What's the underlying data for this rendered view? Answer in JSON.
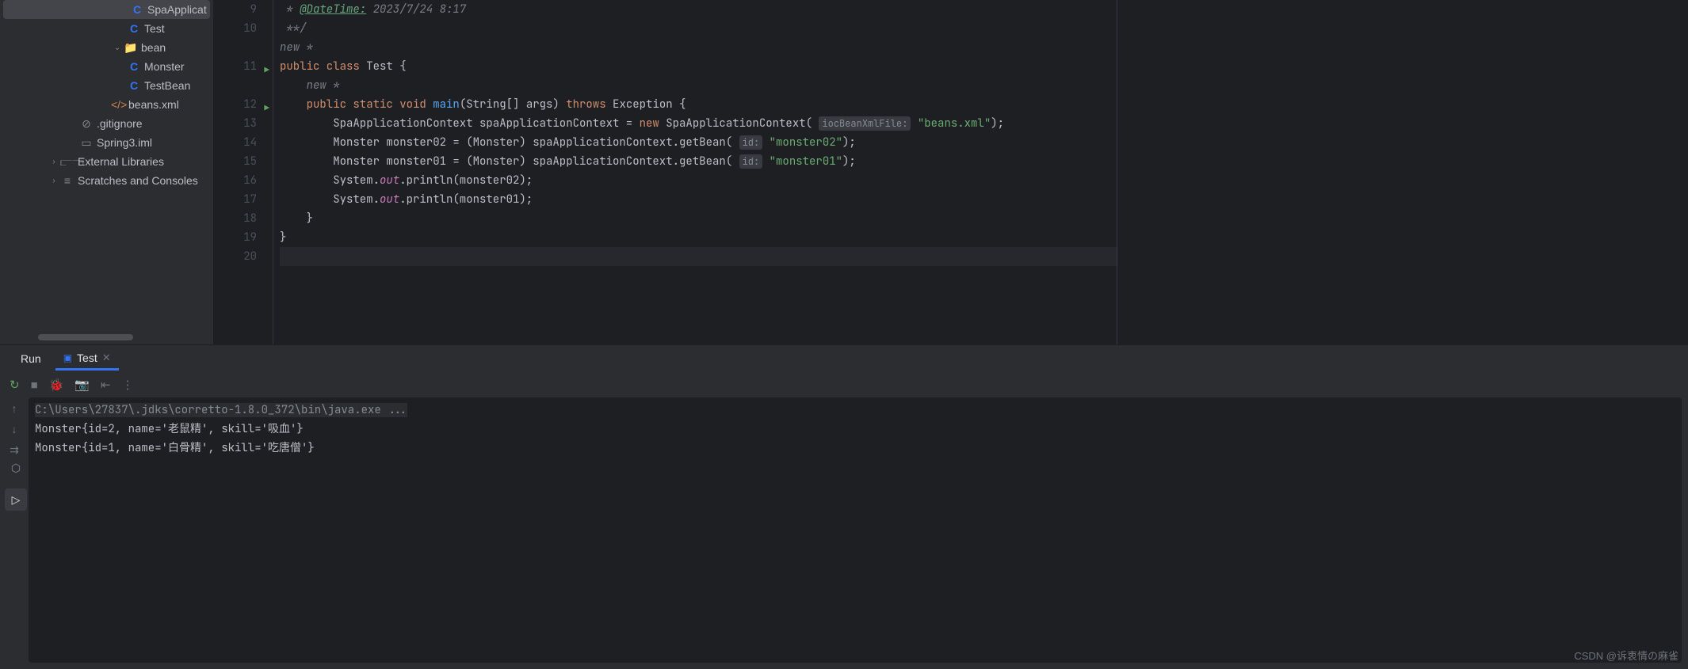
{
  "sidebar": {
    "items": [
      {
        "label": "SpaApplicat",
        "icon": "C",
        "iconClass": "icon-class",
        "indent": "indent-4",
        "selected": true
      },
      {
        "label": "Test",
        "icon": "C",
        "iconClass": "icon-class",
        "indent": "indent-4"
      },
      {
        "label": "bean",
        "icon": "📁",
        "iconClass": "icon-folder",
        "indent": "indent-3",
        "chevron": "⌄"
      },
      {
        "label": "Monster",
        "icon": "C",
        "iconClass": "icon-class",
        "indent": "indent-4"
      },
      {
        "label": "TestBean",
        "icon": "C",
        "iconClass": "icon-class",
        "indent": "indent-4"
      },
      {
        "label": "beans.xml",
        "icon": "</>",
        "iconClass": "icon-xml",
        "indent": "indent-3"
      },
      {
        "label": ".gitignore",
        "icon": "⊘",
        "iconClass": "icon-gitignore",
        "indent": "indent-2"
      },
      {
        "label": "Spring3.iml",
        "icon": "▭",
        "iconClass": "icon-iml",
        "indent": "indent-2"
      },
      {
        "label": "External Libraries",
        "icon": "⫍⫎",
        "iconClass": "icon-folder",
        "indent": "indent-1",
        "chevron": "›"
      },
      {
        "label": "Scratches and Consoles",
        "icon": "≡",
        "iconClass": "icon-folder",
        "indent": "indent-1",
        "chevron": "›"
      }
    ]
  },
  "editor": {
    "lines": [
      {
        "num": "9",
        "segments": [
          {
            "t": " * ",
            "c": "c-comment"
          },
          {
            "t": "@DateTime:",
            "c": "c-doctag"
          },
          {
            "t": " 2023/7/24 8:17",
            "c": "c-comment"
          }
        ]
      },
      {
        "num": "10",
        "segments": [
          {
            "t": " **/",
            "c": "c-comment"
          }
        ]
      },
      {
        "num": "",
        "segments": [
          {
            "t": "new *",
            "c": "c-new"
          }
        ]
      },
      {
        "num": "11",
        "run": true,
        "segments": [
          {
            "t": "public class ",
            "c": "c-keyword"
          },
          {
            "t": "Test {",
            "c": "c-default"
          }
        ]
      },
      {
        "num": "",
        "segments": [
          {
            "t": "    new *",
            "c": "c-new"
          }
        ]
      },
      {
        "num": "12",
        "run": true,
        "segments": [
          {
            "t": "    ",
            "c": ""
          },
          {
            "t": "public static void ",
            "c": "c-keyword"
          },
          {
            "t": "main",
            "c": "c-method"
          },
          {
            "t": "(String[] args) ",
            "c": "c-default"
          },
          {
            "t": "throws ",
            "c": "c-keyword"
          },
          {
            "t": "Exception {",
            "c": "c-default"
          }
        ]
      },
      {
        "num": "13",
        "segments": [
          {
            "t": "        SpaApplicationContext spaApplicationContext = ",
            "c": "c-default"
          },
          {
            "t": "new ",
            "c": "c-keyword"
          },
          {
            "t": "SpaApplicationContext( ",
            "c": "c-default"
          },
          {
            "t": "iocBeanXmlFile:",
            "c": "c-hint"
          },
          {
            "t": " ",
            "c": ""
          },
          {
            "t": "\"beans.xml\"",
            "c": "c-string"
          },
          {
            "t": ");",
            "c": "c-default"
          }
        ]
      },
      {
        "num": "14",
        "segments": [
          {
            "t": "        Monster monster02 = (Monster) spaApplicationContext.getBean( ",
            "c": "c-default"
          },
          {
            "t": "id:",
            "c": "c-hint"
          },
          {
            "t": " ",
            "c": ""
          },
          {
            "t": "\"monster02\"",
            "c": "c-string"
          },
          {
            "t": ");",
            "c": "c-default"
          }
        ]
      },
      {
        "num": "15",
        "segments": [
          {
            "t": "        Monster monster01 = (Monster) spaApplicationContext.getBean( ",
            "c": "c-default"
          },
          {
            "t": "id:",
            "c": "c-hint"
          },
          {
            "t": " ",
            "c": ""
          },
          {
            "t": "\"monster01\"",
            "c": "c-string"
          },
          {
            "t": ");",
            "c": "c-default"
          }
        ]
      },
      {
        "num": "16",
        "segments": [
          {
            "t": "        System.",
            "c": "c-default"
          },
          {
            "t": "out",
            "c": "c-field"
          },
          {
            "t": ".println(monster02);",
            "c": "c-default"
          }
        ]
      },
      {
        "num": "17",
        "segments": [
          {
            "t": "        System.",
            "c": "c-default"
          },
          {
            "t": "out",
            "c": "c-field"
          },
          {
            "t": ".println(monster01);",
            "c": "c-default"
          }
        ]
      },
      {
        "num": "18",
        "segments": [
          {
            "t": "    }",
            "c": "c-default"
          }
        ]
      },
      {
        "num": "19",
        "segments": [
          {
            "t": "}",
            "c": "c-default"
          }
        ]
      },
      {
        "num": "20",
        "cursor": true,
        "segments": [
          {
            "t": "",
            "c": ""
          }
        ]
      }
    ]
  },
  "run": {
    "label": "Run",
    "tab": "Test",
    "console": {
      "cmd": "C:\\Users\\27837\\.jdks\\corretto-1.8.0_372\\bin\\java.exe ...",
      "out1": "Monster{id=2, name='老鼠精', skill='吸血'}",
      "out2": "Monster{id=1, name='白骨精', skill='吃唐僧'}"
    }
  },
  "watermark": "CSDN @诉衷情の麻雀"
}
